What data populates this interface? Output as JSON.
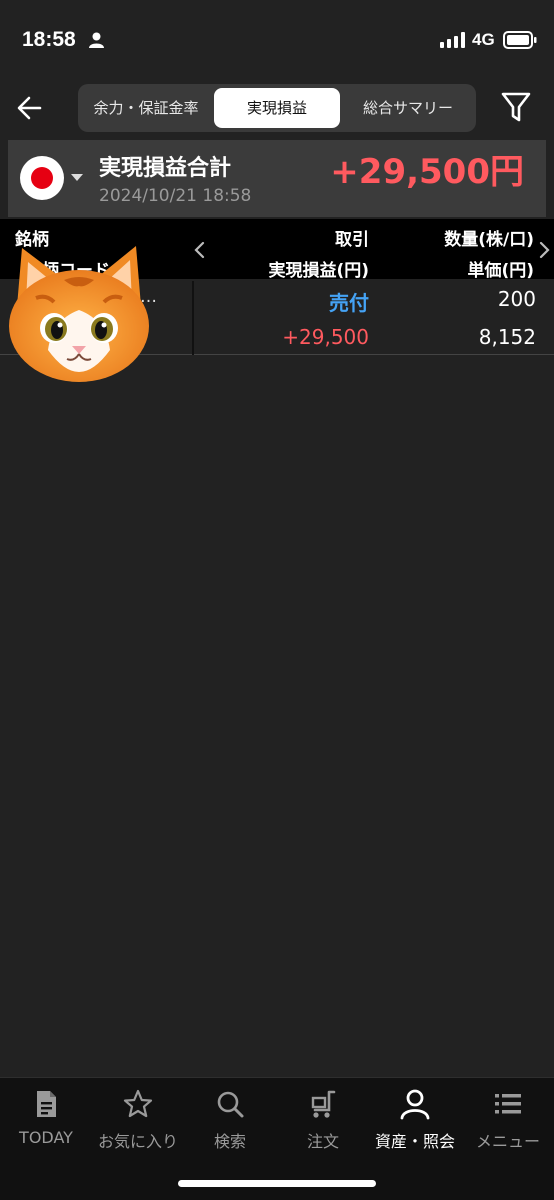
{
  "status_bar": {
    "time": "18:58",
    "network": "4G"
  },
  "tabs": [
    {
      "label": "余力・保証金率",
      "active": false
    },
    {
      "label": "実現損益",
      "active": true
    },
    {
      "label": "総合サマリー",
      "active": false
    }
  ],
  "summary": {
    "title": "実現損益合計",
    "datetime": "2024/10/21 18:58",
    "total": "+29,500円",
    "market_flag": "japan-flag"
  },
  "table": {
    "headers": {
      "name": "銘柄",
      "code": "柄コード",
      "trade": "取引",
      "pnl": "実現損益(円)",
      "qty": "数量(株/口)",
      "price": "単価(円)"
    },
    "rows": [
      {
        "name_suffix": "…",
        "trade": "売付",
        "pnl": "+29,500",
        "qty": "200",
        "price": "8,152"
      }
    ]
  },
  "bottom_nav": [
    {
      "label": "TODAY",
      "icon": "document-icon",
      "active": false
    },
    {
      "label": "お気に入り",
      "icon": "star-icon",
      "active": false
    },
    {
      "label": "検索",
      "icon": "search-icon",
      "active": false
    },
    {
      "label": "注文",
      "icon": "cart-icon",
      "active": false
    },
    {
      "label": "資産・照会",
      "icon": "person-icon",
      "active": true
    },
    {
      "label": "メニュー",
      "icon": "menu-icon",
      "active": false
    }
  ],
  "colors": {
    "positive": "#ff5a5f",
    "sell": "#45a3f5",
    "background": "#222222"
  }
}
